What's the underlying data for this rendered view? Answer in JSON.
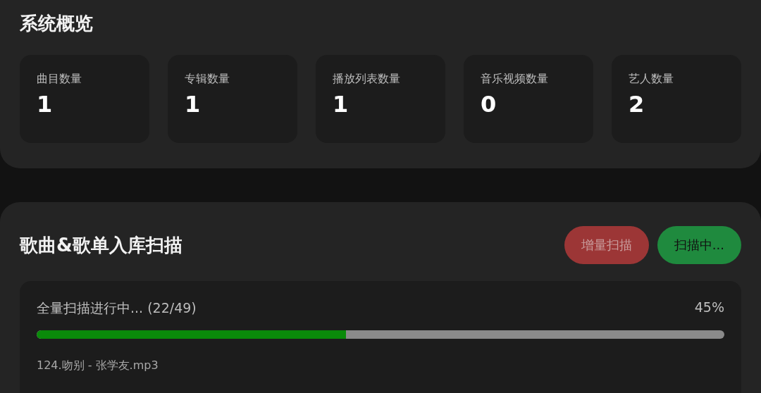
{
  "overview": {
    "title": "系统概览",
    "stats": [
      {
        "label": "曲目数量",
        "value": "1"
      },
      {
        "label": "专辑数量",
        "value": "1"
      },
      {
        "label": "播放列表数量",
        "value": "1"
      },
      {
        "label": "音乐视频数量",
        "value": "0"
      },
      {
        "label": "艺人数量",
        "value": "2"
      }
    ]
  },
  "scan": {
    "title": "歌曲&歌单入库扫描",
    "buttons": [
      {
        "label": "增量扫描",
        "kind": "danger",
        "disabled": true
      },
      {
        "label": "扫描中...",
        "kind": "success",
        "disabled": false
      }
    ],
    "progress": {
      "status": "全量扫描进行中... (22/49)",
      "percent": "45%",
      "level": 0.45,
      "file": "124.吻别 - 张学友.mp3"
    }
  }
}
